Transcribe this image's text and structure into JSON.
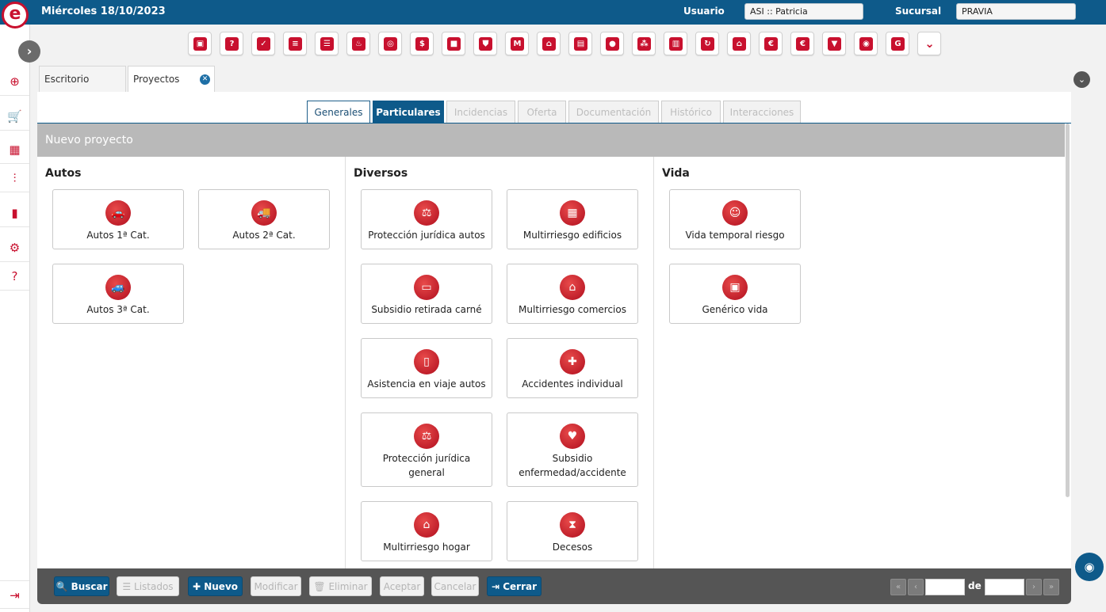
{
  "header": {
    "date": "Miércoles 18/10/2023",
    "user_label": "Usuario",
    "user_value": "ASI :: Patricia",
    "branch_label": "Sucursal",
    "branch_value": "PRAVIA"
  },
  "logo": {
    "letter": "e"
  },
  "rail": {
    "expand_glyph": "›",
    "items": [
      {
        "name": "add-circle-icon",
        "glyph": "⊕"
      },
      {
        "name": "cart-icon",
        "glyph": "🛒"
      },
      {
        "name": "buildings-icon",
        "glyph": "▦"
      },
      {
        "name": "sliders-icon",
        "glyph": "⫶"
      },
      {
        "name": "bar-chart-icon",
        "glyph": "▮"
      },
      {
        "name": "gear-icon",
        "glyph": "⚙"
      },
      {
        "name": "help-icon",
        "glyph": "?"
      },
      {
        "name": "logout-icon",
        "glyph": "⇥"
      }
    ]
  },
  "toolbar_icons": [
    {
      "name": "cube-icon",
      "glyph": "▣"
    },
    {
      "name": "user-question-icon",
      "glyph": "?"
    },
    {
      "name": "user-check-icon",
      "glyph": "✓"
    },
    {
      "name": "document-icon",
      "glyph": "≡"
    },
    {
      "name": "list-icon",
      "glyph": "☰"
    },
    {
      "name": "flame-icon",
      "glyph": "♨"
    },
    {
      "name": "target-icon",
      "glyph": "◎"
    },
    {
      "name": "money-icon",
      "glyph": "$"
    },
    {
      "name": "briefcase-icon",
      "glyph": "■"
    },
    {
      "name": "shopping-bag-icon",
      "glyph": "⛊"
    },
    {
      "name": "brand-m-icon",
      "glyph": "M"
    },
    {
      "name": "house-document-icon",
      "glyph": "⌂"
    },
    {
      "name": "building-grid-icon",
      "glyph": "▤"
    },
    {
      "name": "agent-icon",
      "glyph": "●"
    },
    {
      "name": "group-icon",
      "glyph": "⁂"
    },
    {
      "name": "building-add-icon",
      "glyph": "▥"
    },
    {
      "name": "currency-exchange-icon",
      "glyph": "↻"
    },
    {
      "name": "users-home-icon",
      "glyph": "⌂"
    },
    {
      "name": "euro-icon",
      "glyph": "€"
    },
    {
      "name": "euro-home-icon",
      "glyph": "€"
    },
    {
      "name": "shield-down-icon",
      "glyph": "▼"
    },
    {
      "name": "eye-icon",
      "glyph": "◉"
    },
    {
      "name": "brand-g-icon",
      "glyph": "G"
    },
    {
      "name": "chevron-down-icon",
      "glyph": "⌄"
    }
  ],
  "doc_tabs": [
    {
      "label": "Escritorio"
    },
    {
      "label": "Proyectos",
      "close": "✕"
    }
  ],
  "collapse_glyph": "⌄",
  "subtabs": [
    {
      "label": "Generales"
    },
    {
      "label": "Particulares"
    },
    {
      "label": "Incidencias"
    },
    {
      "label": "Oferta"
    },
    {
      "label": "Documentación"
    },
    {
      "label": "Histórico"
    },
    {
      "label": "Interacciones"
    }
  ],
  "section_title": "Nuevo proyecto",
  "columns": [
    {
      "title": "Autos",
      "cards": [
        {
          "label": "Autos 1ª Cat.",
          "icon": "car-icon",
          "glyph": "🚗"
        },
        {
          "label": "Autos 2ª Cat.",
          "icon": "truck-icon",
          "glyph": "🚚"
        },
        {
          "label": "Autos 3ª Cat.",
          "icon": "car-crash-icon",
          "glyph": "🚙"
        }
      ]
    },
    {
      "title": "Diversos",
      "cards": [
        {
          "label": "Protección jurídica autos",
          "icon": "scales-car-icon",
          "glyph": "⚖"
        },
        {
          "label": "Multirriesgo edificios",
          "icon": "building-icon",
          "glyph": "▦"
        },
        {
          "label": "Subsidio retirada carné",
          "icon": "id-card-icon",
          "glyph": "▭"
        },
        {
          "label": "Multirriesgo comercios",
          "icon": "store-icon",
          "glyph": "⌂"
        },
        {
          "label": "Asistencia en viaje autos",
          "icon": "travel-car-icon",
          "glyph": "▯"
        },
        {
          "label": "Accidentes individual",
          "icon": "medical-cross-icon",
          "glyph": "✚"
        },
        {
          "label": "Protección jurídica general",
          "icon": "scales-icon",
          "glyph": "⚖"
        },
        {
          "label": "Subsidio enfermedad/accidente",
          "icon": "heart-icon",
          "glyph": "♥"
        },
        {
          "label": "Multirriesgo hogar",
          "icon": "home-icon",
          "glyph": "⌂"
        },
        {
          "label": "Decesos",
          "icon": "hourglass-icon",
          "glyph": "⧗"
        }
      ]
    },
    {
      "title": "Vida",
      "cards": [
        {
          "label": "Vida temporal riesgo",
          "icon": "family-icon",
          "glyph": "☺"
        },
        {
          "label": "Genérico vida",
          "icon": "life-generic-icon",
          "glyph": "▣"
        }
      ]
    }
  ],
  "bottom_buttons": [
    {
      "label": "Buscar",
      "icon": "search-icon",
      "glyph": "🔍",
      "enabled": true
    },
    {
      "label": "Listados",
      "icon": "list-icon",
      "glyph": "☰",
      "enabled": false
    },
    {
      "label": "Nuevo",
      "icon": "plus-icon",
      "glyph": "✚",
      "enabled": true
    },
    {
      "label": "Modificar",
      "enabled": false
    },
    {
      "label": "Eliminar",
      "icon": "trash-icon",
      "glyph": "🗑",
      "enabled": false
    },
    {
      "label": "Aceptar",
      "enabled": false
    },
    {
      "label": "Cancelar",
      "enabled": false
    },
    {
      "label": "Cerrar",
      "icon": "exit-icon",
      "glyph": "⇥",
      "enabled": true
    }
  ],
  "pager": {
    "first": "«",
    "prev": "‹",
    "of_label": "de",
    "next": "›",
    "last": "»"
  },
  "float_eye_glyph": "◉"
}
